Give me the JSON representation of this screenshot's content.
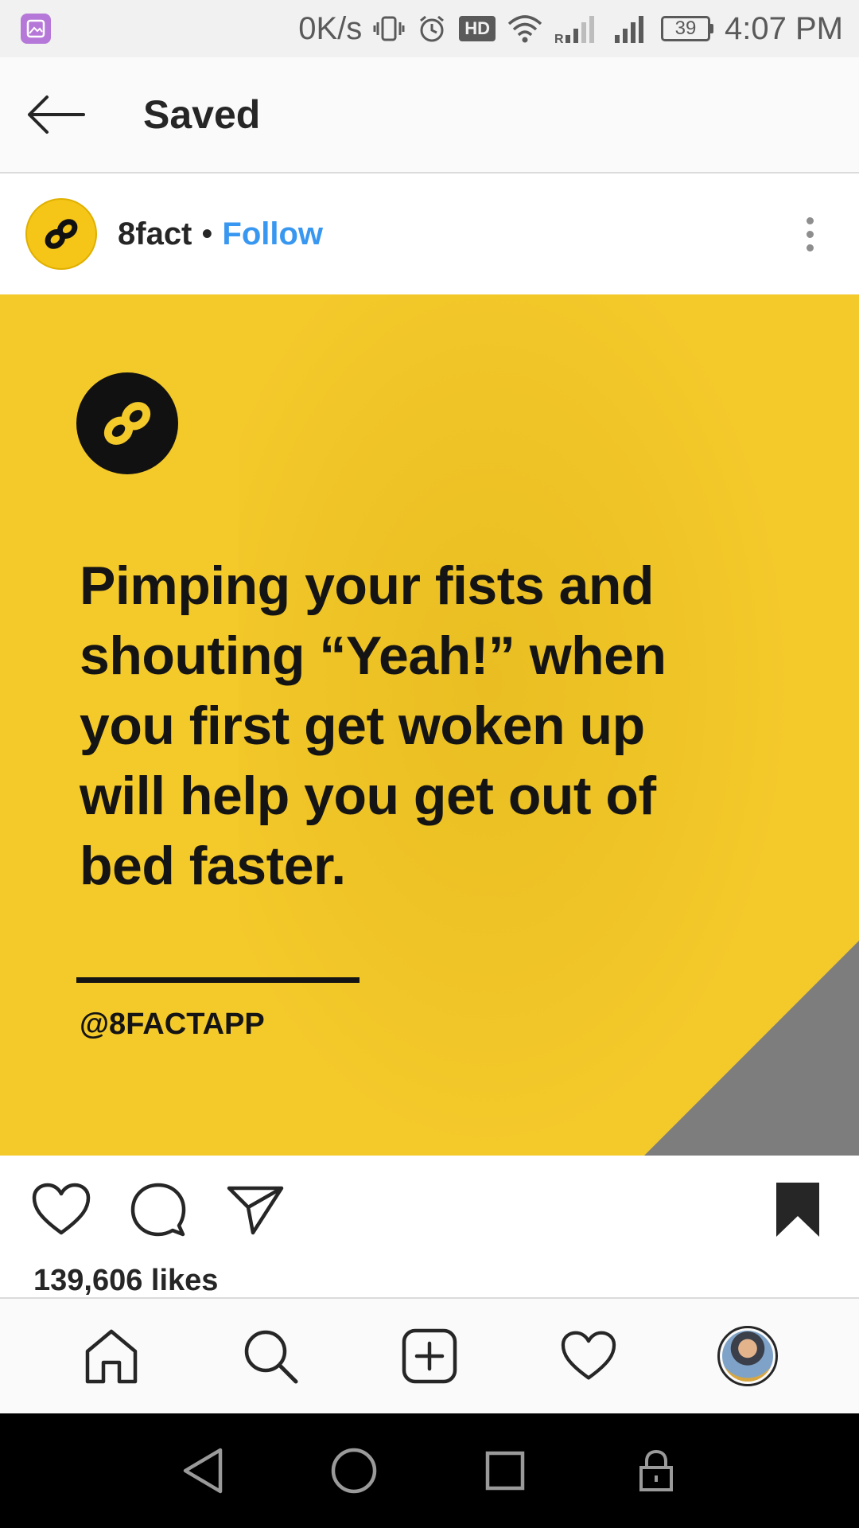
{
  "status_bar": {
    "speed": "0K/s",
    "hd": "HD",
    "signal_label": "R",
    "battery": "39",
    "time": "4:07 PM"
  },
  "header": {
    "title": "Saved"
  },
  "post": {
    "username": "8fact",
    "separator": "•",
    "follow_label": "Follow",
    "image": {
      "fact_text": "Pimping your fists and shouting “Yeah!” when you first get woken up will help you get out of bed faster.",
      "handle": "@8FACTAPP",
      "brand_color": "#f4c92a"
    },
    "likes": "139,606 likes"
  },
  "colors": {
    "accent": "#3897f0",
    "text": "#262626",
    "header_bg": "#fafafa"
  }
}
